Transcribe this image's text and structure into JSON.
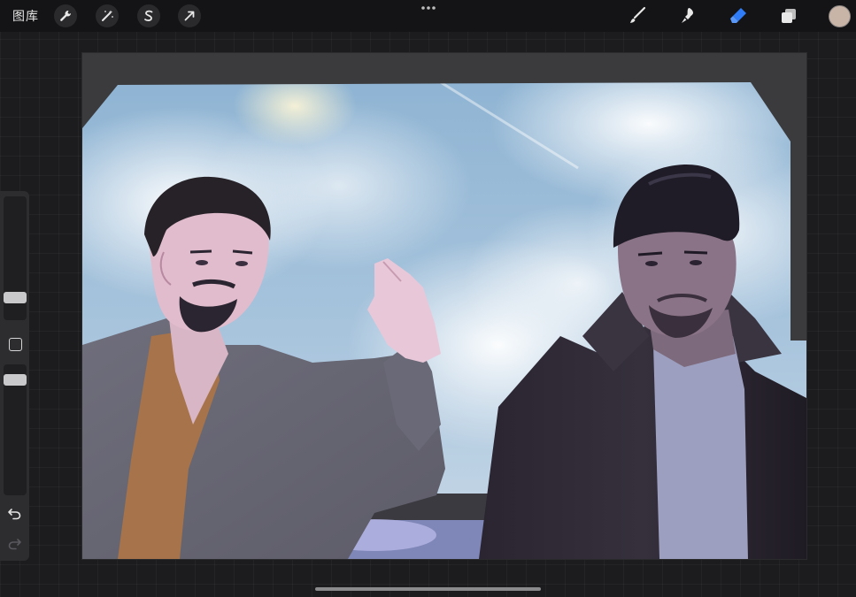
{
  "toolbar": {
    "gallery_label": "图库",
    "actions": [
      {
        "name": "actions-wrench-icon"
      },
      {
        "name": "adjustments-wand-icon"
      },
      {
        "name": "selection-s-icon"
      },
      {
        "name": "transform-arrow-icon"
      }
    ],
    "tools": [
      {
        "name": "brush-icon",
        "active": false
      },
      {
        "name": "smudge-icon",
        "active": false
      },
      {
        "name": "eraser-icon",
        "active": true
      },
      {
        "name": "layers-icon",
        "active": false
      }
    ],
    "current_color": "#c9b5a7",
    "accent_color": "#2f7cf6"
  },
  "sidebar": {
    "brush_size_level": 0.2,
    "opacity_level": 0.85,
    "modify_icon": "square-outline-icon",
    "undo_icon": "undo-icon",
    "redo_icon": "redo-icon"
  }
}
